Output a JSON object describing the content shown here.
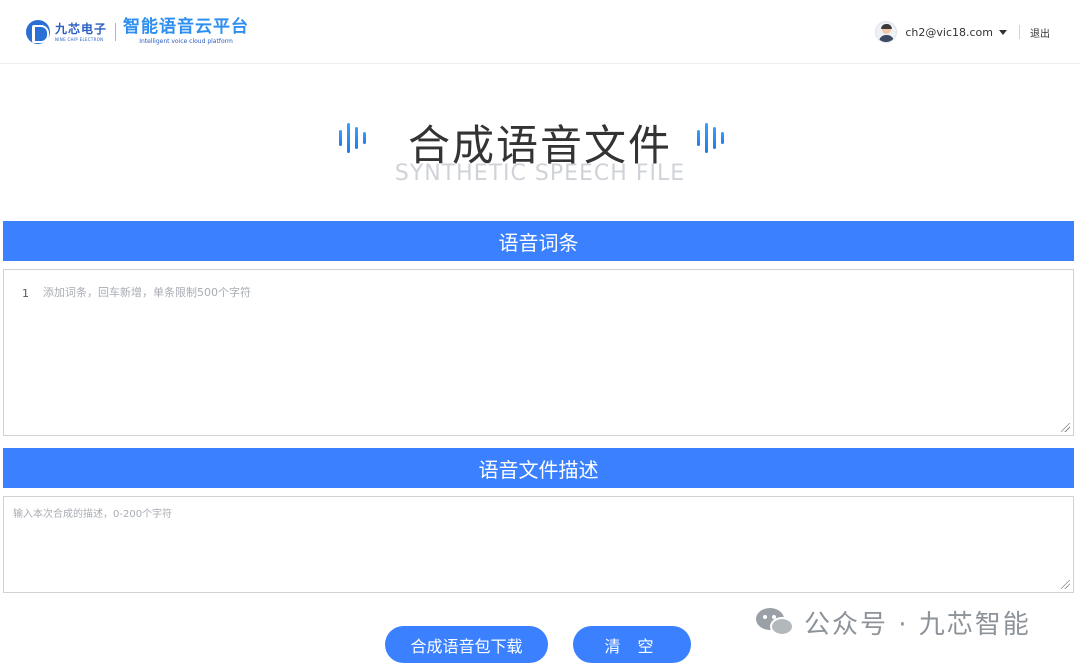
{
  "header": {
    "company_name": "九芯电子",
    "company_sub": "NINE CHIP ELECTRON",
    "platform_name": "智能语音云平台",
    "platform_sub": "Intelligent voice cloud platform",
    "user_email": "ch2@vic18.com",
    "logout_label": "退出"
  },
  "title": {
    "cn": "合成语音文件",
    "en": "SYNTHETIC SPEECH FILE"
  },
  "entries_section": {
    "header": "语音词条",
    "line_number": "1",
    "placeholder": "添加词条，回车新增，单条限制500个字符"
  },
  "description_section": {
    "header": "语音文件描述",
    "placeholder": "输入本次合成的描述，0-200个字符"
  },
  "buttons": {
    "synthesize_download": "合成语音包下载",
    "clear": "清 空"
  },
  "watermark": {
    "text": "公众号 · 九芯智能"
  },
  "colors": {
    "accent": "#3a80ff",
    "brand_blue": "#2e8ff0",
    "placeholder_gray": "#a8adb3"
  },
  "icons": {
    "logo": "nine-chip-logo-icon",
    "user": "user-avatar-icon",
    "dropdown": "caret-down-icon",
    "sound_wave": "sound-wave-icon",
    "wechat": "wechat-icon"
  }
}
